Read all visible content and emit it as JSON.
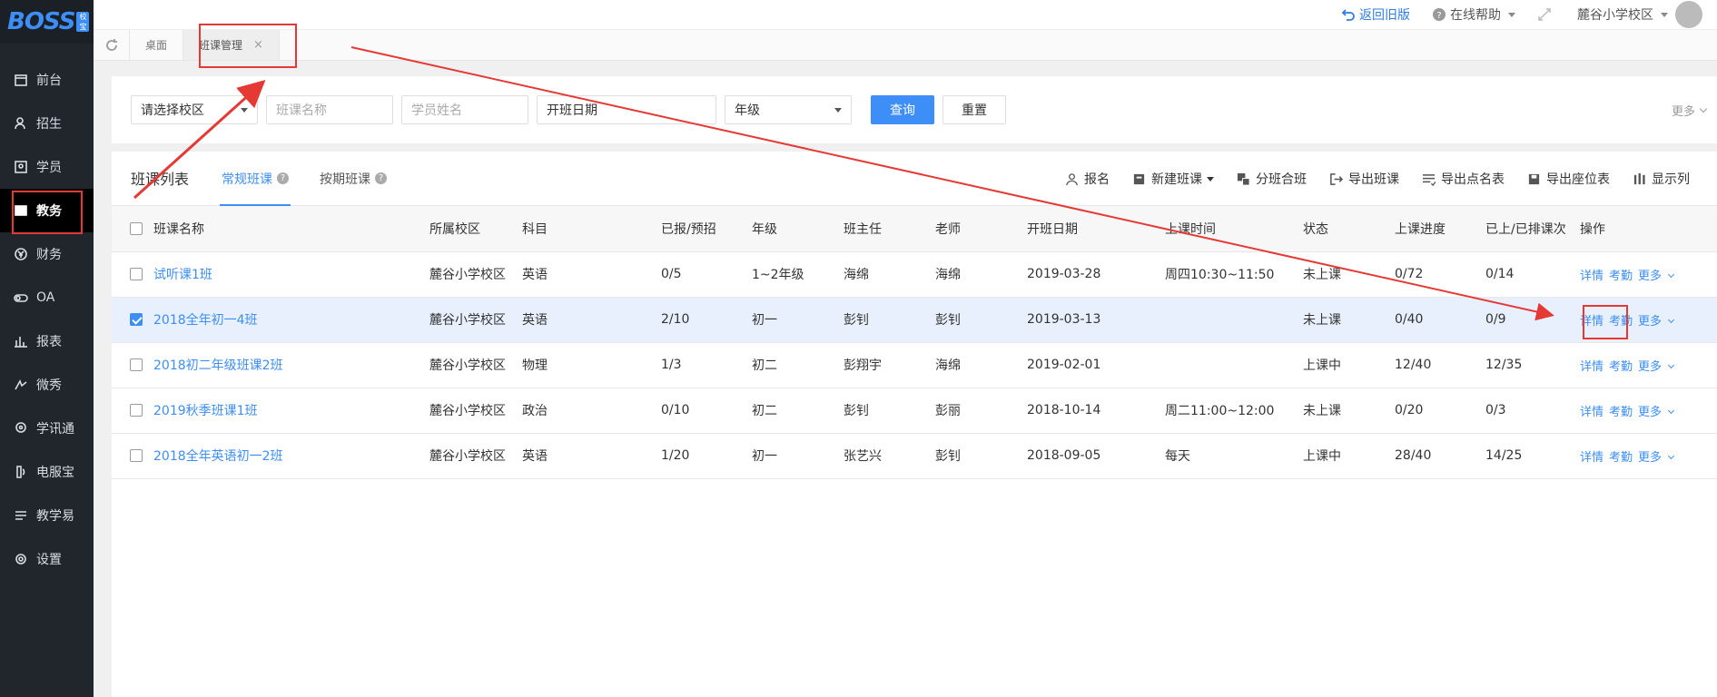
{
  "brand": {
    "logo_text": "BOSS",
    "badge_text": "校宝"
  },
  "sidebar": {
    "items": [
      {
        "label": "前台",
        "icon": "calendar-icon"
      },
      {
        "label": "招生",
        "icon": "user-plus-icon"
      },
      {
        "label": "学员",
        "icon": "id-card-icon"
      },
      {
        "label": "教务",
        "icon": "book-icon",
        "active": true
      },
      {
        "label": "财务",
        "icon": "yen-icon"
      },
      {
        "label": "OA",
        "icon": "toggle-icon"
      },
      {
        "label": "报表",
        "icon": "bar-chart-icon"
      },
      {
        "label": "微秀",
        "icon": "xiu-icon"
      },
      {
        "label": "学讯通",
        "icon": "location-icon"
      },
      {
        "label": "电服宝",
        "icon": "phone-icon"
      },
      {
        "label": "教学易",
        "icon": "teach-icon"
      },
      {
        "label": "设置",
        "icon": "gear-icon"
      }
    ]
  },
  "topbar": {
    "back_label": "返回旧版",
    "help_label": "在线帮助",
    "campus_label": "麓谷小学校区"
  },
  "tabs": {
    "desk_label": "桌面",
    "current_label": "班课管理",
    "close": "×"
  },
  "filter": {
    "campus_placeholder": "请选择校区",
    "class_name_placeholder": "班课名称",
    "student_name_placeholder": "学员姓名",
    "start_date_label": "开班日期",
    "grade_label": "年级",
    "search_label": "查询",
    "reset_label": "重置",
    "more_label": "更多"
  },
  "list": {
    "title": "班课列表",
    "tab_regular": "常规班课",
    "tab_period": "按期班课",
    "toolbar": {
      "enroll": "报名",
      "new_class": "新建班课",
      "split_merge": "分班合班",
      "export_class": "导出班课",
      "export_roll": "导出点名表",
      "export_seats": "导出座位表",
      "show_columns": "显示列"
    },
    "columns": [
      "班课名称",
      "所属校区",
      "科目",
      "已报/预招",
      "年级",
      "班主任",
      "老师",
      "开班日期",
      "上课时间",
      "状态",
      "上课进度",
      "已上/已排课次",
      "操作"
    ],
    "ops": {
      "detail": "详情",
      "attendance": "考勤",
      "more": "更多"
    },
    "rows": [
      {
        "name": "试听课1班",
        "campus": "麓谷小学校区",
        "subject": "英语",
        "enrolled": "0/5",
        "grade": "1~2年级",
        "head": "海绵",
        "teacher": "海绵",
        "start": "2019-03-28",
        "time": "周四10:30~11:50",
        "status": "未上课",
        "progress": "0/72",
        "sessions": "0/14",
        "checked": false
      },
      {
        "name": "2018全年初一4班",
        "campus": "麓谷小学校区",
        "subject": "英语",
        "enrolled": "2/10",
        "grade": "初一",
        "head": "彭钊",
        "teacher": "彭钊",
        "start": "2019-03-13",
        "time": "",
        "status": "未上课",
        "progress": "0/40",
        "sessions": "0/9",
        "checked": true
      },
      {
        "name": "2018初二年级班课2班",
        "campus": "麓谷小学校区",
        "subject": "物理",
        "enrolled": "1/3",
        "grade": "初二",
        "head": "彭翔宇",
        "teacher": "海绵",
        "start": "2019-02-01",
        "time": "",
        "status": "上课中",
        "progress": "12/40",
        "sessions": "12/35",
        "checked": false
      },
      {
        "name": "2019秋季班课1班",
        "campus": "麓谷小学校区",
        "subject": "政治",
        "enrolled": "0/10",
        "grade": "初二",
        "head": "彭钊",
        "teacher": "彭丽",
        "start": "2018-10-14",
        "time": "周二11:00~12:00",
        "status": "未上课",
        "progress": "0/20",
        "sessions": "0/3",
        "checked": false
      },
      {
        "name": "2018全年英语初一2班",
        "campus": "麓谷小学校区",
        "subject": "英语",
        "enrolled": "1/20",
        "grade": "初一",
        "head": "张艺兴",
        "teacher": "彭钊",
        "start": "2018-09-05",
        "time": "每天",
        "status": "上课中",
        "progress": "28/40",
        "sessions": "14/25",
        "checked": false
      }
    ]
  },
  "colors": {
    "accent": "#3d8ef6",
    "annotation": "#e53935",
    "sidebar": "#21262d"
  }
}
